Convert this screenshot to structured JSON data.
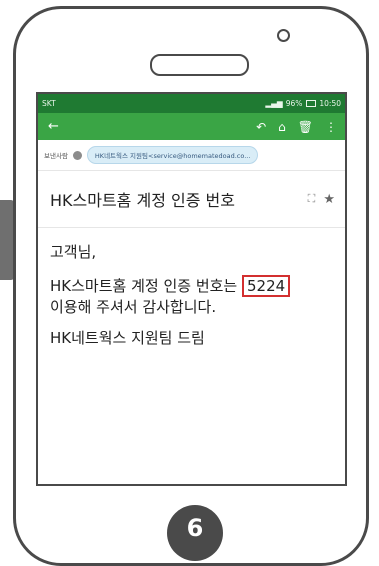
{
  "status_bar": {
    "carrier": "SKT",
    "battery_percent": "96%",
    "time": "10:50"
  },
  "toolbar": {
    "back_icon": "←",
    "reply_icon": "↶",
    "move_icon": "⌂",
    "delete_icon": "🗑",
    "more_icon": "⋮"
  },
  "sender": {
    "label": "보낸사람",
    "address": "HK네트웍스 지원팀<service@homematedoad.co..."
  },
  "email": {
    "subject": "HK스마트홈 계정 인증 번호",
    "greeting": "고객님,",
    "body_before_code": "HK스마트홈 계정 인증 번호는 ",
    "code": "5224",
    "body_after_code": "이용해 주셔서 감사합니다.",
    "signature": "HK네트웍스 지원팀 드림"
  },
  "step_number": "6",
  "colors": {
    "statusbar": "#1f7a32",
    "appbar": "#3aa545",
    "highlight": "#d32f2f",
    "frame": "#4a4a4a"
  }
}
